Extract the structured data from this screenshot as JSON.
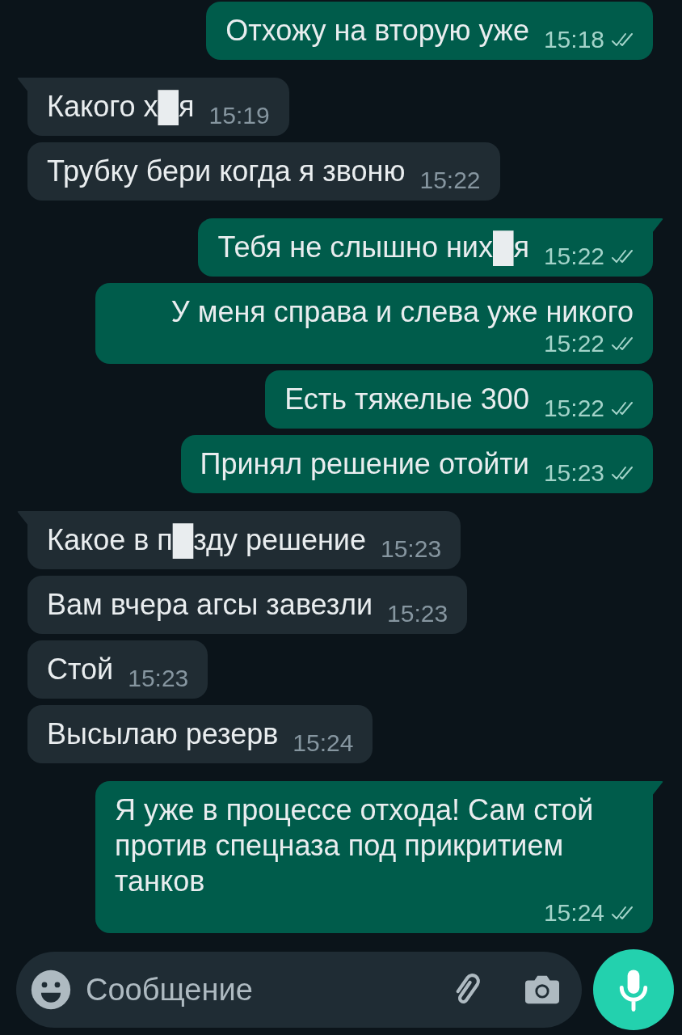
{
  "messages": [
    {
      "kind": "outgoing",
      "tail": false,
      "text": "Отхожу на вторую уже",
      "time": "15:18",
      "delivered": true
    },
    {
      "kind": "incoming",
      "tail": true,
      "text": "Какого х█я",
      "time": "15:19"
    },
    {
      "kind": "incoming",
      "tail": false,
      "text": "Трубку бери когда я звоню",
      "time": "15:22"
    },
    {
      "kind": "outgoing",
      "tail": true,
      "text": "Тебя не слышно них█я",
      "time": "15:22",
      "delivered": true
    },
    {
      "kind": "outgoing",
      "tail": false,
      "text": "У меня справа и слева уже никого",
      "time": "15:22",
      "delivered": true
    },
    {
      "kind": "outgoing",
      "tail": false,
      "text": "Есть тяжелые 300",
      "time": "15:22",
      "delivered": true
    },
    {
      "kind": "outgoing",
      "tail": false,
      "text": "Принял решение отойти",
      "time": "15:23",
      "delivered": true
    },
    {
      "kind": "incoming",
      "tail": true,
      "text": "Какое в п█зду решение",
      "time": "15:23"
    },
    {
      "kind": "incoming",
      "tail": false,
      "text": "Вам вчера агсы завезли",
      "time": "15:23"
    },
    {
      "kind": "incoming",
      "tail": false,
      "text": "Стой",
      "time": "15:23"
    },
    {
      "kind": "incoming",
      "tail": false,
      "text": "Высылаю резерв",
      "time": "15:24"
    },
    {
      "kind": "outgoing",
      "tail": true,
      "text": "Я уже в процессе отхода! Сам стой против спецназа под прикритием танков",
      "time": "15:24",
      "delivered": true
    }
  ],
  "composer": {
    "placeholder": "Сообщение"
  }
}
